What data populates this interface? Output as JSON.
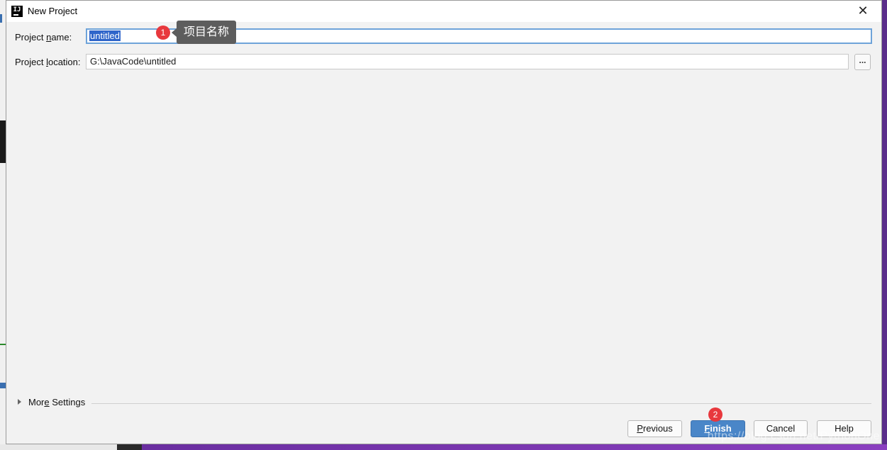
{
  "window": {
    "title": "New Project",
    "close_glyph": "✕",
    "icon": "intellij-idea-icon"
  },
  "form": {
    "project_name": {
      "label_pre": "Project ",
      "label_mnemonic": "n",
      "label_post": "ame:",
      "value": "untitled"
    },
    "project_location": {
      "label_pre": "Project ",
      "label_mnemonic": "l",
      "label_post": "ocation:",
      "value": "G:\\JavaCode\\untitled",
      "browse_label": "..."
    }
  },
  "annotations": {
    "badge1": "1",
    "tooltip1": "项目名称",
    "badge2": "2"
  },
  "more_settings": {
    "label_pre": "Mor",
    "label_mnemonic": "e",
    "label_post": " Settings"
  },
  "buttons": {
    "previous": {
      "mnemonic": "P",
      "rest": "revious"
    },
    "finish": {
      "mnemonic": "F",
      "rest": "inish"
    },
    "cancel": "Cancel",
    "help": "Help"
  },
  "watermark": "https://blog.csdn.net/PythonOne",
  "colors": {
    "accent": "#4a86c8",
    "selection": "#2f65ca",
    "badge": "#e8383d"
  }
}
